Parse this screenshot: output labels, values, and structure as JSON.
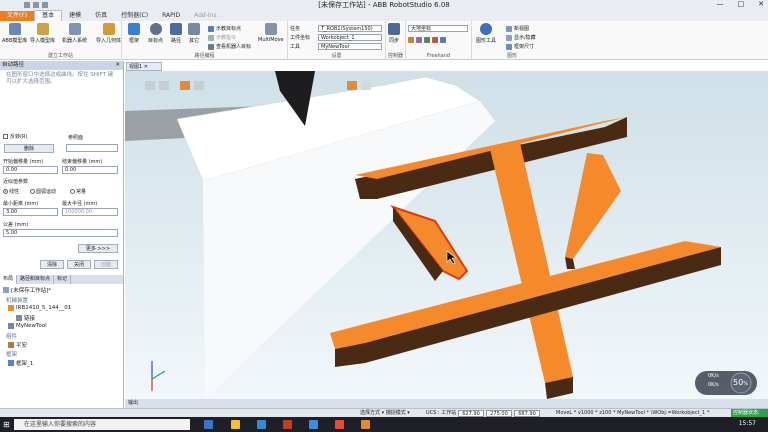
{
  "window": {
    "title": "[未保存工作站] - ABB RobotStudio 6.08",
    "controls": [
      "—",
      "□",
      "✕"
    ]
  },
  "tabs": [
    {
      "label": "文件(F)",
      "state": "file"
    },
    {
      "label": "基本",
      "state": "active"
    },
    {
      "label": "建模",
      "state": ""
    },
    {
      "label": "仿真",
      "state": ""
    },
    {
      "label": "控制器(C)",
      "state": ""
    },
    {
      "label": "RAPID",
      "state": ""
    },
    {
      "label": "Add-Ins",
      "state": "dis"
    }
  ],
  "ribbon": {
    "group_build": {
      "label": "建立工作站",
      "buttons": [
        "ABB模型库",
        "导入模型库",
        "机器人系统",
        "导入几何体",
        "框架"
      ]
    },
    "group_path": {
      "label": "路径编程",
      "buttons": [
        "目标点",
        "路径",
        "其它"
      ],
      "small": [
        "示教目标点",
        "示教指令",
        "查看机器人目标"
      ],
      "multimove": "MultiMove"
    },
    "group_settings": {
      "label": "设置",
      "labels": [
        "任务",
        "工件坐标",
        "工具"
      ],
      "values": [
        "T_ROB1(System150)",
        "Workobject_1",
        "MyNewTool"
      ]
    },
    "group_controller": {
      "label": "控制器",
      "button": "同步"
    },
    "group_freehand": {
      "label": "Freehand",
      "combo": "大地坐标"
    },
    "group_graphics": {
      "label": "图形",
      "button": "图形工具",
      "small": [
        "新视图",
        "显示/隐藏",
        "框架尺寸"
      ]
    }
  },
  "panel": {
    "title": "自动路径",
    "info": "在图形窗口中选择边或曲线。按住 SHIFT 键可以扩大选择范围。",
    "reverse_label": "反转(R)",
    "ref_label": "参照面",
    "delete_label": "删除",
    "start_offset_label": "开始偏移量 (mm)",
    "start_offset_value": "0.00",
    "end_offset_label": "结束偏移量 (mm)",
    "end_offset_value": "0.00",
    "approx_label": "近似值参数",
    "opt_linear": "线性",
    "opt_circular": "圆弧运动",
    "opt_constant": "常量",
    "min_dist_label": "最小距离 (mm)",
    "min_dist_value": "3.00",
    "max_radius_label": "最大半径 (mm)",
    "max_radius_value": "100000.00",
    "tolerance_label": "公差 (mm)",
    "tolerance_value": "5.00",
    "more_label": "更多 >>>",
    "clear_label": "清除",
    "close_label": "关闭",
    "create_label": "创建"
  },
  "layout_tabs": [
    "布局",
    "路径和目标点",
    "标记"
  ],
  "tree": {
    "station": "[未保存工作站]*",
    "cat_mechanisms": "机械装置",
    "robot": "IRB1410_5_144__01",
    "link": "链接",
    "tool": "MyNewTool",
    "cat_parts": "组件",
    "part": "平安",
    "cat_frames": "框架",
    "frame": "框架_1"
  },
  "view_tab": "视图1",
  "output_label": "输出",
  "status": {
    "left": "选择方式 ▾  捕捉模式 ▾",
    "ucs": "UCS : 工作站",
    "coords": [
      "627.90",
      "275.00",
      "687.90"
    ],
    "info": "MoveL * v1000 * z100 * MyNewTool * \\WObj:=Workobject_1 *",
    "controller": "控制器状态: 1/1"
  },
  "taskbar": {
    "search_placeholder": "在这里输入你要搜索的内容",
    "time": "15:57"
  },
  "badge": {
    "percent": "50",
    "up": "0K/s",
    "down": "0K/s"
  },
  "colors": {
    "part_top": "#f58a2c",
    "part_side": "#4a2a12",
    "accent": "#f07c1e"
  }
}
